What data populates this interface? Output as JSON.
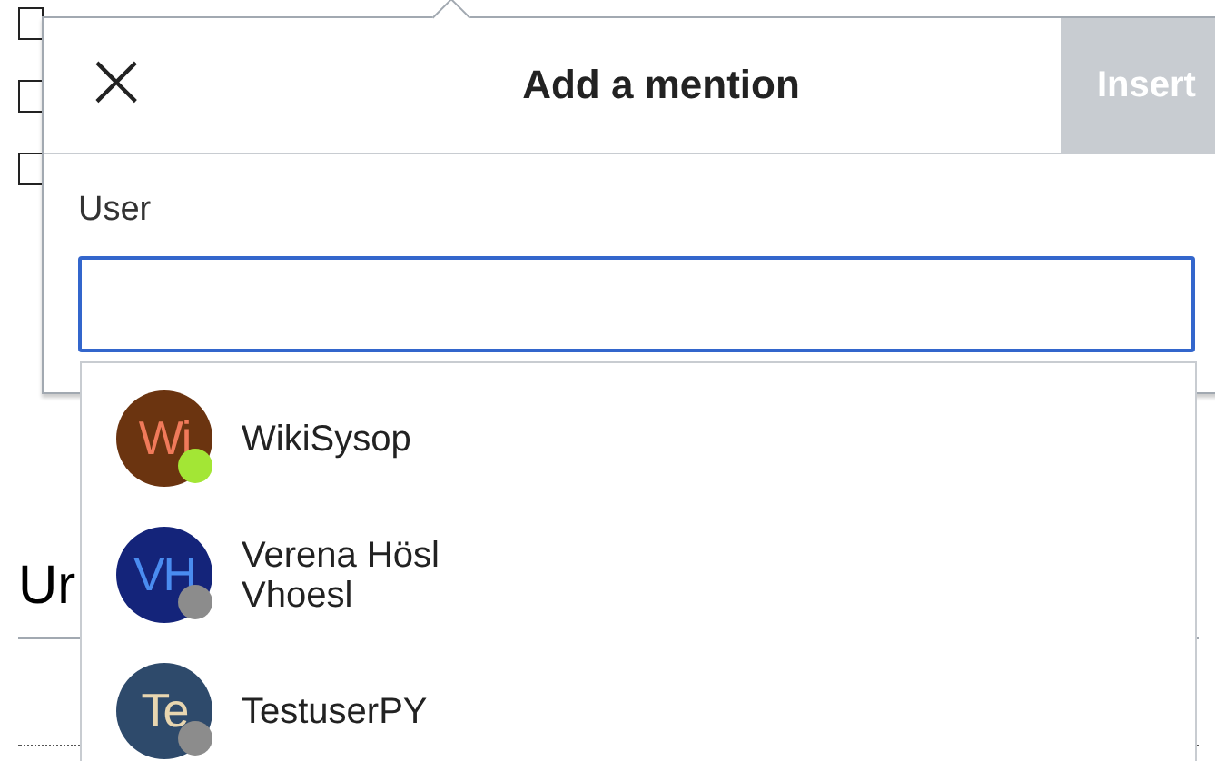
{
  "page": {
    "checkboxes": [
      {
        "checked": false
      },
      {
        "checked": false
      },
      {
        "checked": false
      }
    ],
    "heading": "Ur"
  },
  "dialog": {
    "close": "×",
    "title": "Add a mention",
    "insert_button": {
      "label": "Insert",
      "disabled": true
    },
    "field": {
      "label": "User",
      "focused": true
    },
    "suggestions": [
      {
        "initials": "Wi",
        "color": "#6b3410",
        "online": true,
        "lines": [
          "WikiSysop"
        ]
      },
      {
        "initials": "VH",
        "color": "#14247a",
        "online": false,
        "lines": [
          "Verena Hösl",
          "Vhoesl"
        ]
      },
      {
        "initials": "Te",
        "color": "#2e4a6b",
        "online": false,
        "lines": [
          "TestuserPY"
        ]
      }
    ]
  }
}
